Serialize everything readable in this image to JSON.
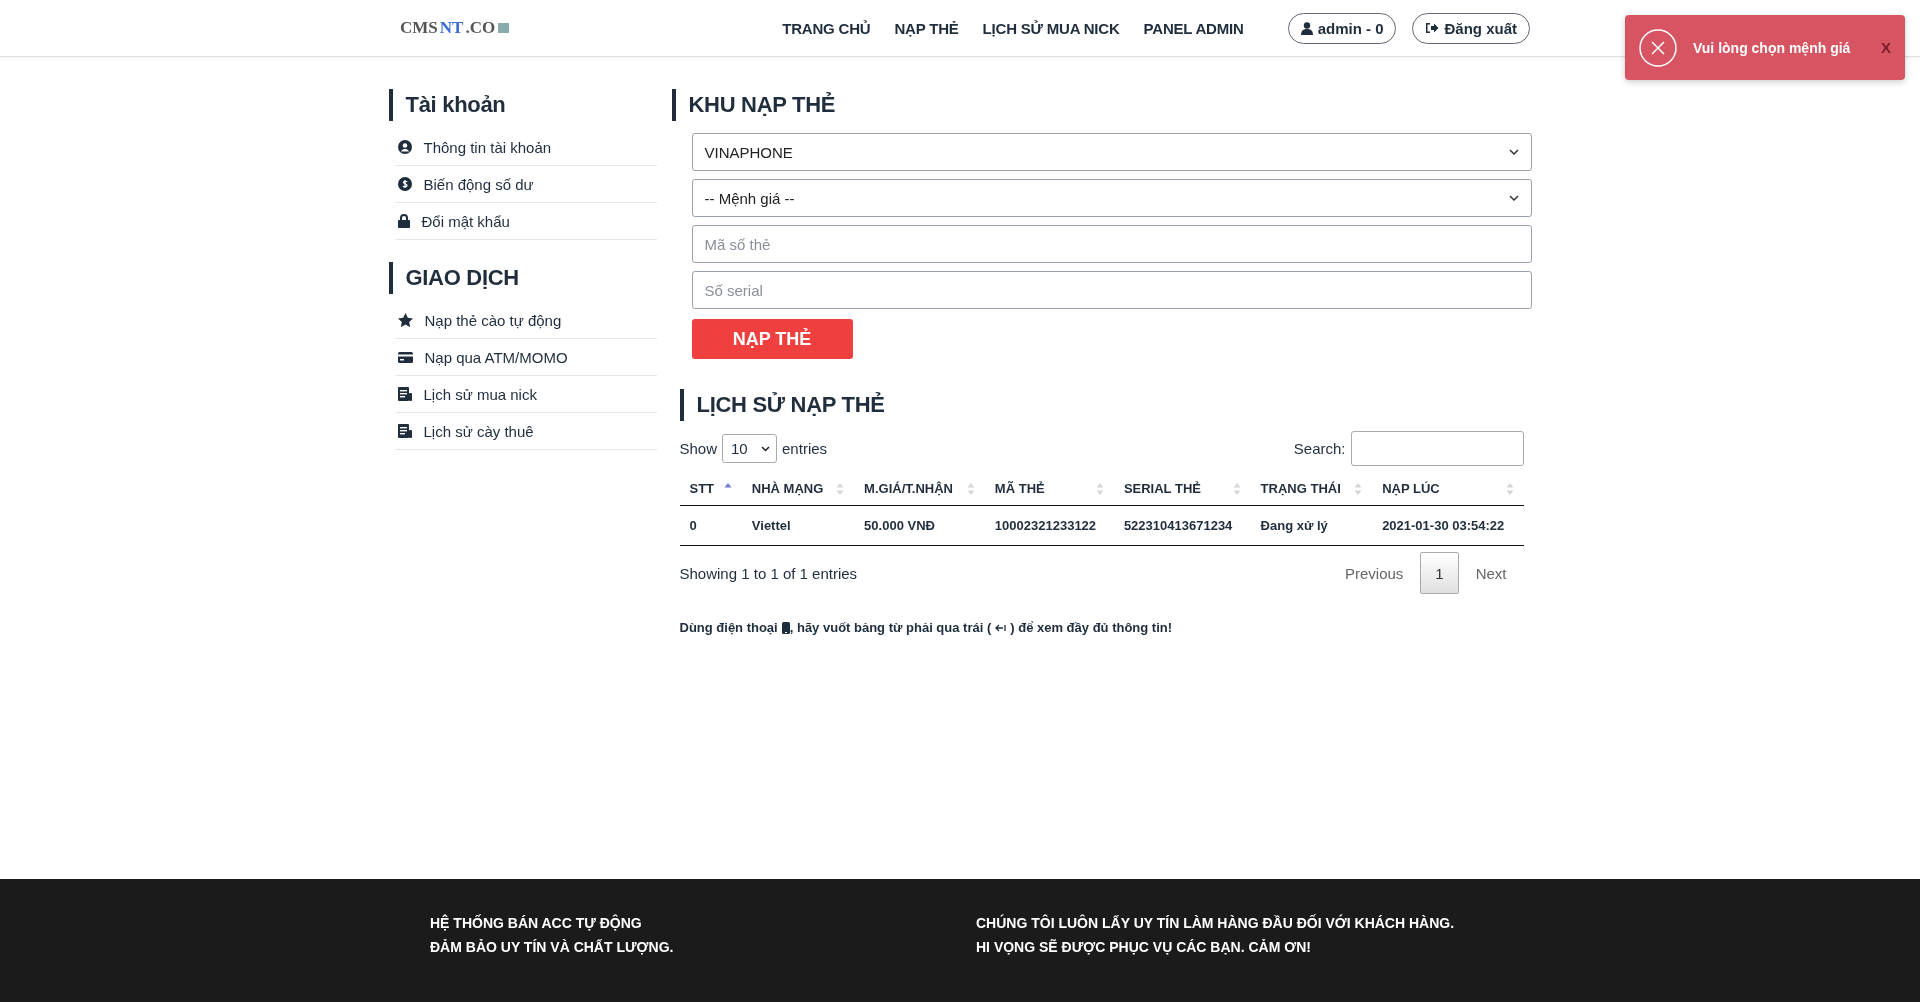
{
  "header": {
    "logo": [
      "CMS",
      "NT",
      ".CO"
    ],
    "nav": [
      "TRANG CHỦ",
      "NẠP THẺ",
      "LỊCH SỬ MUA NICK",
      "PANEL ADMIN"
    ],
    "account_button": "admin - 0",
    "logout_button": "Đăng xuất"
  },
  "toast": {
    "message": "Vui lòng chọn mệnh giá",
    "close": "X"
  },
  "sidebar": [
    {
      "title": "Tài khoản",
      "items": [
        "Thông tin tài khoản",
        "Biến động số dư",
        "Đổi mật khẩu"
      ]
    },
    {
      "title": "GIAO DỊCH",
      "items": [
        "Nạp thẻ cào tự động",
        "Nạp qua ATM/MOMO",
        "Lịch sử mua nick",
        "Lịch sử cày thuê"
      ]
    }
  ],
  "topup": {
    "title": "KHU NẠP THẺ",
    "fields": [
      {
        "kind": "select",
        "value": "VINAPHONE"
      },
      {
        "kind": "select",
        "value": "-- Mệnh giá --"
      },
      {
        "kind": "input",
        "placeholder": "Mã số thẻ"
      },
      {
        "kind": "input",
        "placeholder": "Số serial"
      }
    ],
    "submit": "NẠP THẺ"
  },
  "history": {
    "title": "LỊCH SỬ NẠP THẺ",
    "show_label": "Show",
    "page_size": "10",
    "entries_label": "entries",
    "search_label": "Search:",
    "columns": [
      {
        "label": "STT",
        "sorted": true
      },
      {
        "label": "NHÀ MẠNG",
        "sorted": false
      },
      {
        "label": "M.GIÁ/T.NHẬN",
        "sorted": false
      },
      {
        "label": "MÃ THẺ",
        "sorted": false
      },
      {
        "label": "SERIAL THẺ",
        "sorted": false
      },
      {
        "label": "TRẠNG THÁI",
        "sorted": false
      },
      {
        "label": "NẠP LÚC",
        "sorted": false
      }
    ],
    "rows": [
      [
        "0",
        "Viettel",
        "50.000 VNĐ",
        "10002321233122",
        "522310413671234",
        "Đang xử lý",
        "2021-01-30 03:54:22"
      ]
    ],
    "info": "Showing 1 to 1 of 1 entries",
    "pagination": [
      {
        "label": "Previous",
        "selected": false
      },
      {
        "label": "1",
        "selected": true
      },
      {
        "label": "Next",
        "selected": false
      }
    ],
    "note": [
      "Dùng điện thoại",
      ", hãy vuốt bảng từ phải qua trái (",
      ") để xem đầy đủ thông tin!"
    ]
  },
  "footer": [
    [
      "HỆ THỐNG BÁN ACC TỰ ĐỘNG",
      "ĐẢM BẢO UY TÍN VÀ CHẤT LƯỢNG."
    ],
    [
      "CHÚNG TÔI LUÔN LẤY UY TÍN LÀM HÀNG ĐẦU ĐỐI VỚI KHÁCH HÀNG.",
      "HI VỌNG SẼ ĐƯỢC PHỤC VỤ CÁC BẠN. CẢM ƠN!"
    ]
  ]
}
